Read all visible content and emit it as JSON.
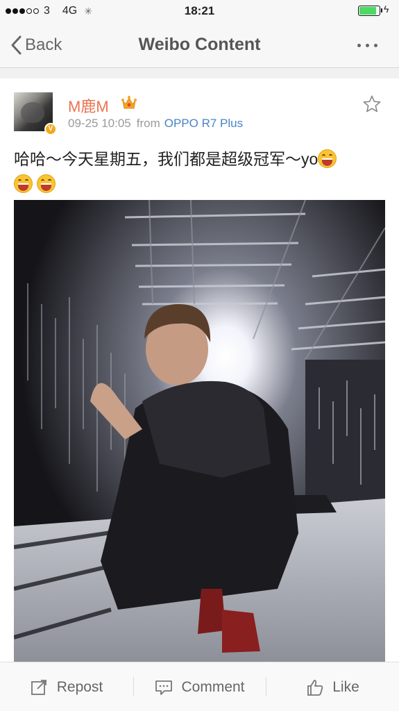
{
  "status_bar": {
    "carrier": "3",
    "network": "4G",
    "time": "18:21",
    "signal_bars": 3,
    "signal_total": 5,
    "battery_level": 0.85,
    "battery_color": "#4cd964"
  },
  "nav": {
    "back_label": "Back",
    "title": "Weibo Content"
  },
  "post": {
    "username": "M鹿M",
    "date": "09-25 10:05",
    "from_label": "from",
    "source": "OPPO R7 Plus",
    "text": "哈哈～今天星期五，我们都是超级冠军～yo",
    "emoji_count": 3,
    "username_color": "#eb7350",
    "source_color": "#4a84c4"
  },
  "toolbar": {
    "repost_label": "Repost",
    "comment_label": "Comment",
    "like_label": "Like"
  }
}
